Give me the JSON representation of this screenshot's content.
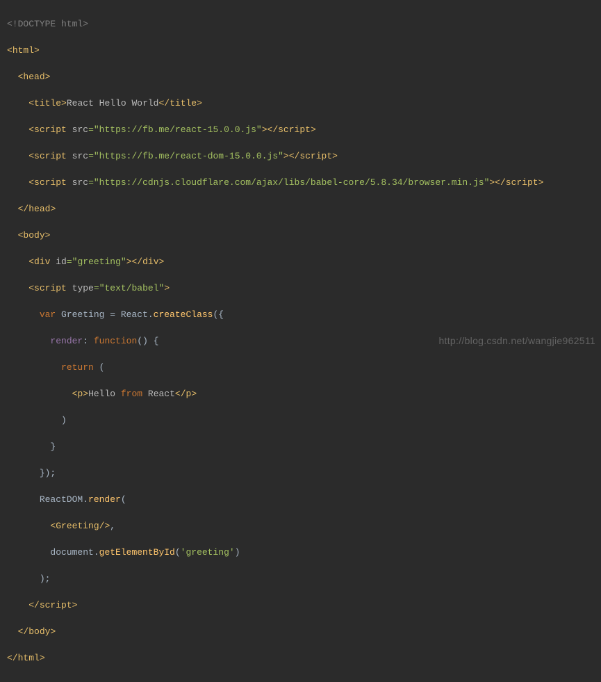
{
  "code": {
    "l1_doctype": "<!DOCTYPE html>",
    "l2_open_html": "html",
    "l3_open_head": "head",
    "l4_open_title": "title",
    "l4_title_text": "React Hello World",
    "l4_close_title": "title",
    "l5_tag": "script",
    "l5_attr": "src",
    "l5_val": "\"https://fb.me/react-15.0.0.js\"",
    "l6_tag": "script",
    "l6_attr": "src",
    "l6_val": "\"https://fb.me/react-dom-15.0.0.js\"",
    "l7_tag": "script",
    "l7_attr": "src",
    "l7_val": "\"https://cdnjs.cloudflare.com/ajax/libs/babel-core/5.8.34/browser.min.js\"",
    "l8_close_head": "head",
    "l9_open_body": "body",
    "l10_tag": "div",
    "l10_attr": "id",
    "l10_val": "\"greeting\"",
    "l11_tag": "script",
    "l11_attr": "type",
    "l11_val": "\"text/babel\"",
    "l12_var": "var",
    "l12_name": " Greeting = React.",
    "l12_method": "createClass",
    "l12_tail": "({",
    "l13_prop": "render",
    "l13_mid": ": ",
    "l13_fn": "function",
    "l13_tail": "() {",
    "l14_return": "return",
    "l14_tail": " (",
    "l15_open_p": "p",
    "l15_text_a": "Hello ",
    "l15_from": "from",
    "l15_text_b": " React",
    "l15_close_p": "p",
    "l16": ")",
    "l17": "}",
    "l18": "});",
    "l19_obj": "ReactDOM.",
    "l19_method": "render",
    "l19_tail": "(",
    "l20_comp": "Greeting",
    "l20_tail": ",",
    "l21_a": "document.",
    "l21_method": "getElementById",
    "l21_b": "(",
    "l21_str": "'greeting'",
    "l21_c": ")",
    "l22": ");",
    "l23_close_script": "script",
    "l24_close_body": "body",
    "l25_close_html": "html"
  },
  "watermark": "http://blog.csdn.net/wangjie962511"
}
